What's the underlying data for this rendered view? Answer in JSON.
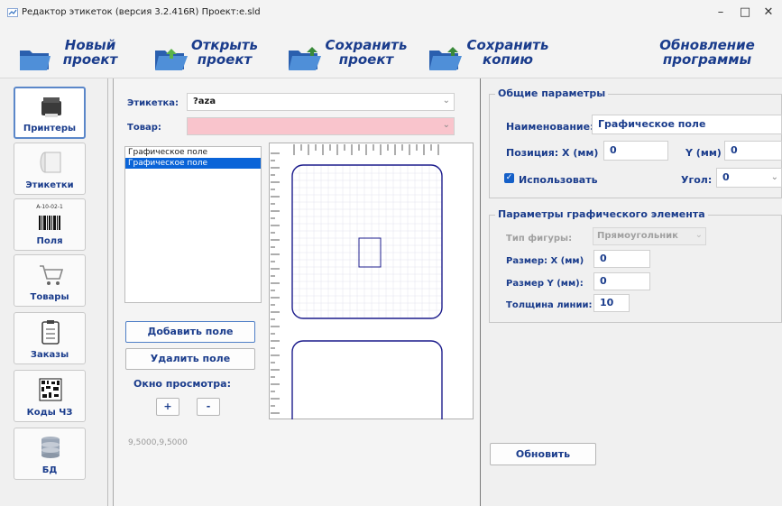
{
  "window": {
    "title": "Редактор этикеток (версия 3.2.416R) Проект:e.sld",
    "controls": [
      "–",
      "□",
      "✕"
    ]
  },
  "toolbar": {
    "new_project": [
      "Новый",
      "проект"
    ],
    "open_project": [
      "Открыть",
      "проект"
    ],
    "save_project": [
      "Сохранить",
      "проект"
    ],
    "save_copy": [
      "Сохранить",
      "копию"
    ],
    "update": [
      "Обновление",
      "программы"
    ]
  },
  "nav": {
    "items": [
      {
        "label": "Принтеры",
        "icon": "printer-icon",
        "active": true
      },
      {
        "label": "Этикетки",
        "icon": "label-roll-icon",
        "active": false
      },
      {
        "label": "Поля",
        "icon": "barcode-icon",
        "active": false,
        "icon_text": "A-10-02-1"
      },
      {
        "label": "Товары",
        "icon": "cart-icon",
        "active": false
      },
      {
        "label": "Заказы",
        "icon": "clipboard-icon",
        "active": false
      },
      {
        "label": "Коды ЧЗ",
        "icon": "datamatrix-icon",
        "active": false
      },
      {
        "label": "БД",
        "icon": "database-icon",
        "active": false
      }
    ]
  },
  "editor": {
    "label_caption": "Этикетка:",
    "label_value": "?aza",
    "product_caption": "Товар:",
    "product_value": "",
    "fields": [
      "Графическое поле",
      "Графическое поле"
    ],
    "selected_field_index": 1,
    "add_field": "Добавить поле",
    "remove_field": "Удалить поле",
    "preview_caption": "Окно просмотра:",
    "zoom_in": "+",
    "zoom_out": "-",
    "coords": "9,5000,9,5000"
  },
  "general": {
    "group_title": "Общие параметры",
    "name_caption": "Наименование:",
    "name_value": "Графическое поле",
    "pos_caption": "Позиция: X (мм)",
    "pos_x": "0",
    "y_caption": "Y (мм)",
    "pos_y": "0",
    "use_caption": "Использовать",
    "use_checked": true,
    "angle_caption": "Угол:",
    "angle_value": "0"
  },
  "graphic": {
    "group_title": "Параметры графического элемента",
    "shape_caption": "Тип фигуры:",
    "shape_value": "Прямоугольник",
    "size_x_caption": "Размер: X (мм)",
    "size_x": "0",
    "size_y_caption": "Размер Y (мм):",
    "size_y": "0",
    "line_caption": "Толщина линии:",
    "line_value": "10"
  },
  "refresh_button": "Обновить",
  "colors": {
    "accent_text": "#1a3c8c",
    "selection": "#0a64d8",
    "preview_line": "#1c1c8c",
    "product_combo_bg": "#f9c4cc",
    "folder": "#2f6fc0"
  }
}
